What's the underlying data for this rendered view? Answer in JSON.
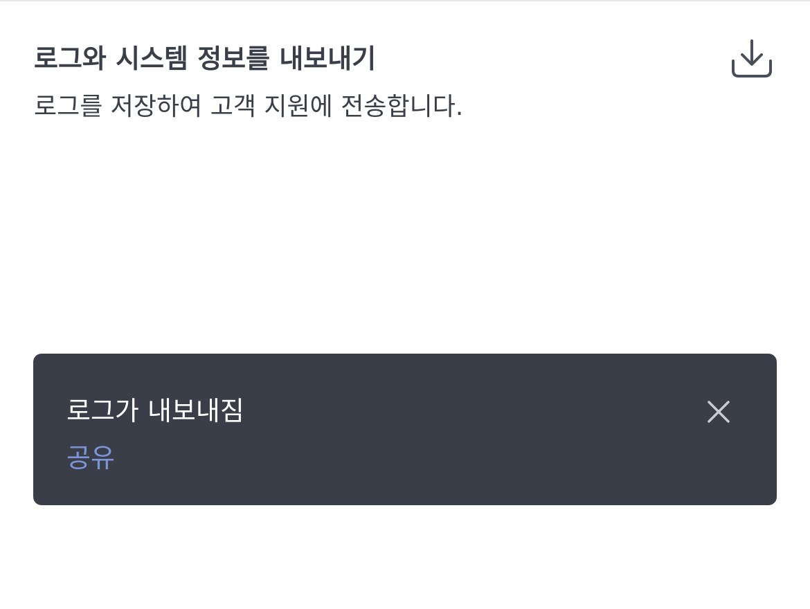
{
  "export_logs": {
    "title": "로그와 시스템 정보를 내보내기",
    "description": "로그를 저장하여 고객 지원에 전송합니다.",
    "icon": "download-icon"
  },
  "toast": {
    "message": "로그가 내보내짐",
    "action_label": "공유",
    "close_icon": "close-icon",
    "colors": {
      "background": "#3a3e49",
      "text": "#ffffff",
      "action": "#7d95d6"
    }
  }
}
